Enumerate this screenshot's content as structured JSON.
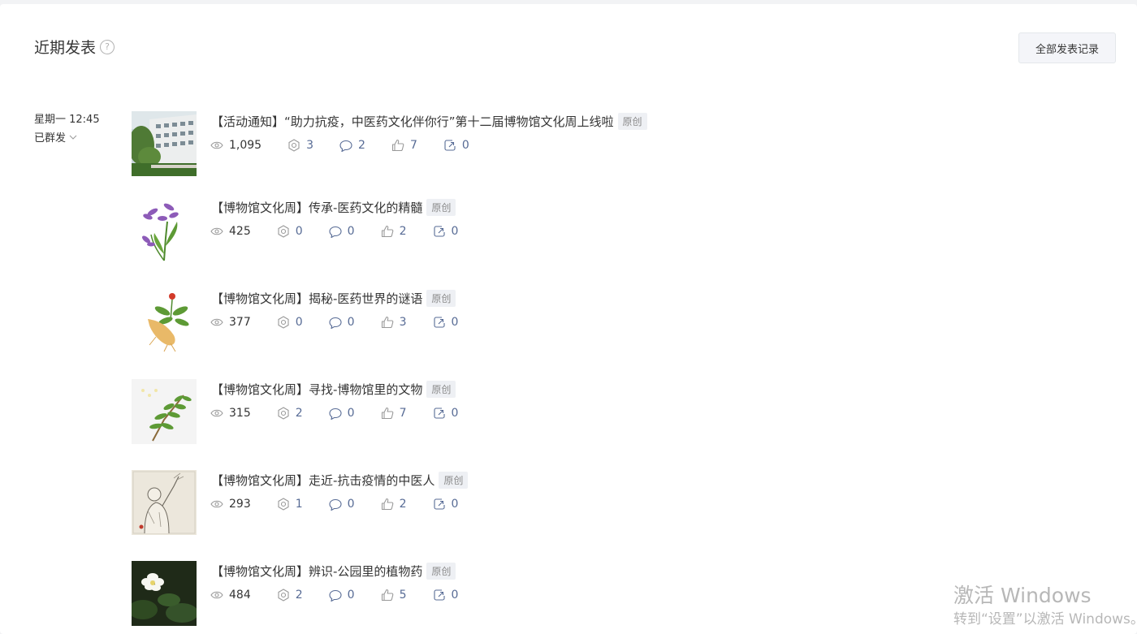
{
  "section": {
    "title": "近期发表",
    "help_icon": "?",
    "all_records_label": "全部发表记录"
  },
  "group": {
    "date": "星期一 12:45",
    "status": "已群发"
  },
  "articles": [
    {
      "title": "【活动通知】“助力抗疫，中医药文化伴你行”第十二届博物馆文化周上线啦",
      "tag": "原创",
      "reads": "1,095",
      "shares": "3",
      "comments": "2",
      "likes": "7",
      "forwards": "0",
      "thumb": "building-photo"
    },
    {
      "title": "【博物馆文化周】传承-医药文化的精髓",
      "tag": "原创",
      "reads": "425",
      "shares": "0",
      "comments": "0",
      "likes": "2",
      "forwards": "0",
      "thumb": "purple-flower-illustration"
    },
    {
      "title": "【博物馆文化周】揭秘-医药世界的谜语",
      "tag": "原创",
      "reads": "377",
      "shares": "0",
      "comments": "0",
      "likes": "3",
      "forwards": "0",
      "thumb": "ginseng-illustration"
    },
    {
      "title": "【博物馆文化周】寻找-博物馆里的文物",
      "tag": "原创",
      "reads": "315",
      "shares": "2",
      "comments": "0",
      "likes": "7",
      "forwards": "0",
      "thumb": "leaf-branch-illustration"
    },
    {
      "title": "【博物馆文化周】走近-抗击疫情的中医人",
      "tag": "原创",
      "reads": "293",
      "shares": "1",
      "comments": "0",
      "likes": "2",
      "forwards": "0",
      "thumb": "doctor-sketch"
    },
    {
      "title": "【博物馆文化周】辨识-公园里的植物药",
      "tag": "原创",
      "reads": "484",
      "shares": "2",
      "comments": "0",
      "likes": "5",
      "forwards": "0",
      "thumb": "white-flower-photo"
    }
  ],
  "watermark": {
    "line1": "激活 Windows",
    "line2": "转到“设置”以激活 Windows。"
  },
  "colors": {
    "accent": "#576b95",
    "text": "#353535",
    "tag_bg": "#eef0f4",
    "muted": "#8a8a8a"
  }
}
